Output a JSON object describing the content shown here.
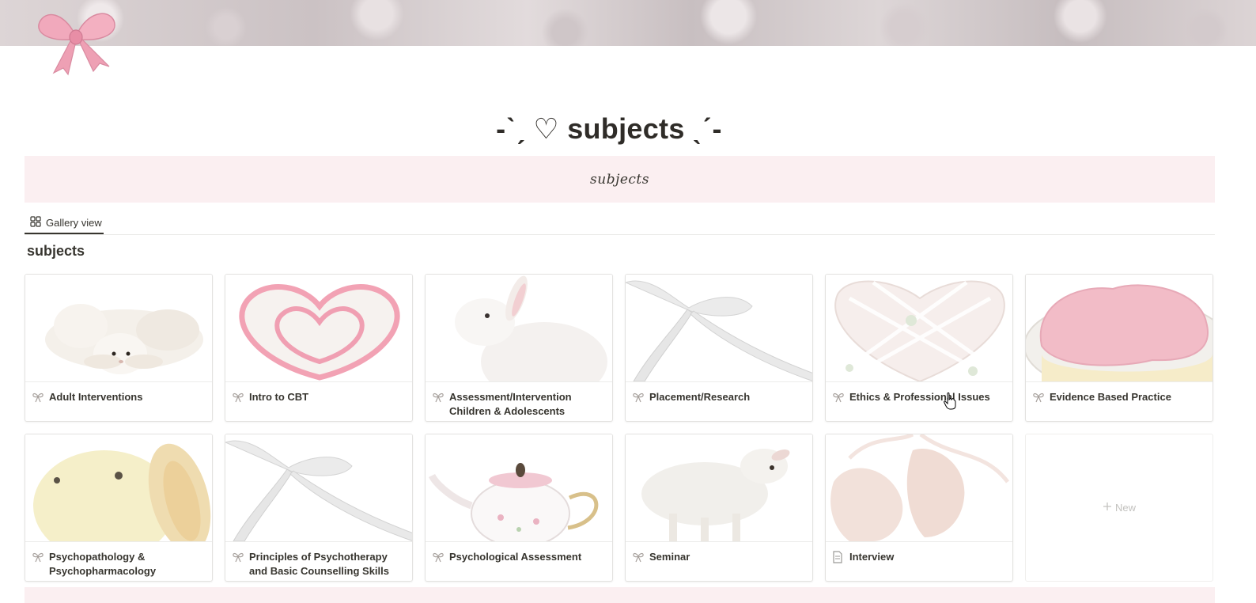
{
  "page": {
    "title": "-ˋˏ ♡ subjects ˎˊ-",
    "page_icon": "pink-bow-icon",
    "cover": "floral-cover-image"
  },
  "callout": {
    "text": "subjects"
  },
  "view_tab": {
    "label": "Gallery view",
    "icon": "gallery-grid-icon"
  },
  "database": {
    "title": "subjects",
    "cards": [
      {
        "title": "Adult Interventions",
        "icon": "ribbon-icon",
        "cover": "lamb-plush"
      },
      {
        "title": "Intro to CBT",
        "icon": "ribbon-icon",
        "cover": "heart-cake"
      },
      {
        "title": "Assessment/Intervention Children & Adolescents",
        "icon": "ribbon-icon",
        "cover": "white-bunny"
      },
      {
        "title": "Placement/Research",
        "icon": "ribbon-icon",
        "cover": "white-ribbon"
      },
      {
        "title": "Ethics & Professional Issues",
        "icon": "ribbon-icon",
        "cover": "heart-pillow"
      },
      {
        "title": "Evidence Based Practice",
        "icon": "ribbon-icon",
        "cover": "pink-pudding"
      },
      {
        "title": "Psychopathology & Psychopharmacology",
        "icon": "ribbon-icon",
        "cover": "bunny-plush"
      },
      {
        "title": "Principles of Psychotherapy and Basic Counselling Skills",
        "icon": "ribbon-icon",
        "cover": "white-ribbon"
      },
      {
        "title": "Psychological Assessment",
        "icon": "ribbon-icon",
        "cover": "teapot"
      },
      {
        "title": "Seminar",
        "icon": "ribbon-icon",
        "cover": "lamb"
      },
      {
        "title": "Interview",
        "icon": "page-icon",
        "cover": "ballet-shoes"
      }
    ],
    "new_label": "New"
  }
}
